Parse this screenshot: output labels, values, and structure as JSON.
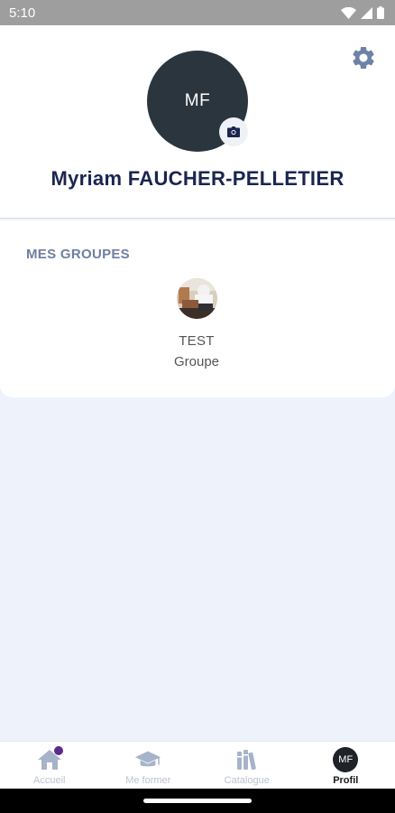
{
  "status_bar": {
    "time": "5:10"
  },
  "profile": {
    "initials": "MF",
    "name": "Myriam FAUCHER-PELLETIER"
  },
  "groups": {
    "title": "MES GROUPES",
    "items": [
      {
        "name": "TEST",
        "type": "Groupe"
      }
    ]
  },
  "bottom_nav": {
    "items": [
      {
        "label": "Accueil",
        "icon": "home-icon",
        "active": false,
        "has_notification": true
      },
      {
        "label": "Me former",
        "icon": "graduation-cap-icon",
        "active": false
      },
      {
        "label": "Catalogue",
        "icon": "books-icon",
        "active": false
      },
      {
        "label": "Profil",
        "icon": "avatar",
        "active": true,
        "avatar_initials": "MF"
      }
    ]
  },
  "colors": {
    "accent": "#1b2550",
    "section_title": "#6f7fa0",
    "page_background": "#eef3fb",
    "notification_dot": "#5a2a8f"
  }
}
